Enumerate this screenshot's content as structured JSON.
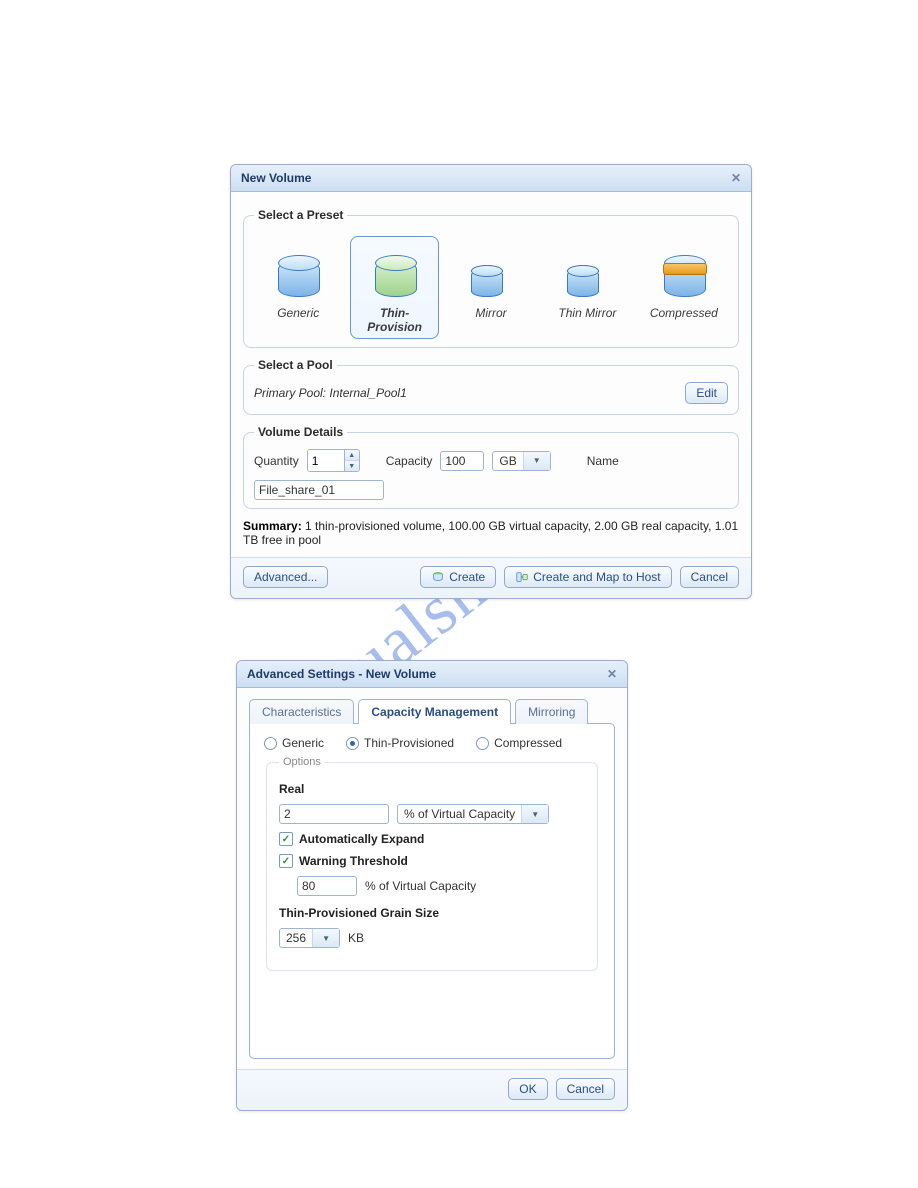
{
  "watermark": "manualshive.com",
  "dialog1": {
    "title": "New Volume",
    "preset_legend": "Select a Preset",
    "presets": [
      "Generic",
      "Thin-Provision",
      "Mirror",
      "Thin Mirror",
      "Compressed"
    ],
    "selected_preset_index": 1,
    "pool_legend": "Select a Pool",
    "pool_label": "Primary Pool:",
    "pool_value": "Internal_Pool1",
    "edit": "Edit",
    "vol_legend": "Volume Details",
    "quantity_label": "Quantity",
    "quantity_value": "1",
    "capacity_label": "Capacity",
    "capacity_value": "100",
    "capacity_unit": "GB",
    "name_label": "Name",
    "name_value": "File_share_01",
    "summary_label": "Summary:",
    "summary_text": " 1 thin-provisioned volume, 100.00 GB virtual capacity, 2.00 GB real capacity, 1.01 TB free in pool",
    "advanced": "Advanced...",
    "create": "Create",
    "create_map": "Create and Map to Host",
    "cancel": "Cancel"
  },
  "dialog2": {
    "title": "Advanced Settings - New Volume",
    "tabs": [
      "Characteristics",
      "Capacity Management",
      "Mirroring"
    ],
    "active_tab_index": 1,
    "type_options": [
      "Generic",
      "Thin-Provisioned",
      "Compressed"
    ],
    "type_selected_index": 1,
    "options_legend": "Options",
    "real_label": "Real",
    "real_value": "2",
    "real_unit": "% of Virtual Capacity",
    "auto_expand": "Automatically Expand",
    "warning_threshold": "Warning Threshold",
    "warning_value": "80",
    "warning_unit": "% of Virtual Capacity",
    "grain_label": "Thin-Provisioned Grain Size",
    "grain_value": "256",
    "grain_unit": "KB",
    "ok": "OK",
    "cancel": "Cancel"
  }
}
